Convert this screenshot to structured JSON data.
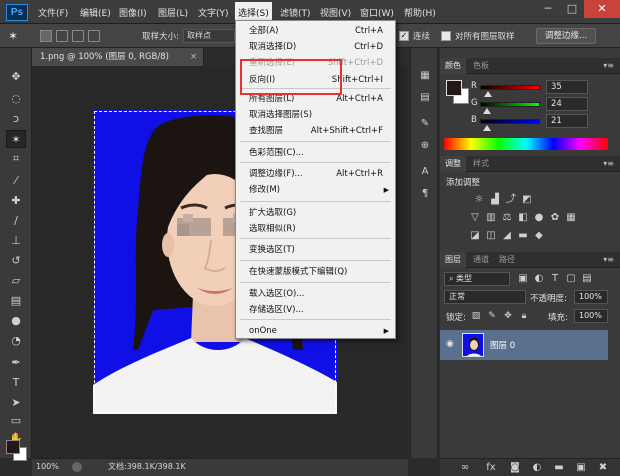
{
  "app": {
    "logo": "Ps"
  },
  "menubar": {
    "items": [
      "文件(F)",
      "编辑(E)",
      "图像(I)",
      "图层(L)",
      "文字(Y)",
      "选择(S)",
      "滤镜(T)",
      "视图(V)",
      "窗口(W)",
      "帮助(H)"
    ],
    "active_index": 5
  },
  "window_controls": {
    "minimize": "─",
    "maximize": "□",
    "close": "✕"
  },
  "options_bar": {
    "sample_size_label": "取样大小:",
    "sample_size_value": "取样点",
    "contiguous_label": "连续",
    "contiguous_checked": true,
    "all_layers_label": "对所有图层取样",
    "all_layers_checked": false,
    "refine_edge_button": "调整边缘..."
  },
  "document": {
    "tab_title": "1.png @ 100% (图层 0, RGB/8)",
    "tab_close": "×",
    "zoom": "100%",
    "doc_info": "文档:398.1K/398.1K"
  },
  "select_menu": {
    "items": [
      {
        "label": "全部(A)",
        "shortcut": "Ctrl+A",
        "disabled": false
      },
      {
        "label": "取消选择(D)",
        "shortcut": "Ctrl+D",
        "disabled": false
      },
      {
        "label": "重新选择(E)",
        "shortcut": "Shift+Ctrl+D",
        "disabled": true
      },
      {
        "label": "反向(I)",
        "shortcut": "Shift+Ctrl+I",
        "disabled": false
      },
      {
        "label": "所有图层(L)",
        "shortcut": "Alt+Ctrl+A",
        "disabled": false
      },
      {
        "label": "取消选择图层(S)",
        "shortcut": "",
        "disabled": false
      },
      {
        "label": "查找图层",
        "shortcut": "Alt+Shift+Ctrl+F",
        "disabled": false
      },
      {
        "label": "色彩范围(C)...",
        "shortcut": "",
        "disabled": false
      },
      {
        "label": "调整边缘(F)...",
        "shortcut": "Alt+Ctrl+R",
        "disabled": false
      },
      {
        "label": "修改(M)",
        "shortcut": "",
        "disabled": false,
        "submenu": true
      },
      {
        "label": "扩大选取(G)",
        "shortcut": "",
        "disabled": false
      },
      {
        "label": "选取相似(R)",
        "shortcut": "",
        "disabled": false
      },
      {
        "label": "变换选区(T)",
        "shortcut": "",
        "disabled": false
      },
      {
        "label": "在快速蒙版模式下编辑(Q)",
        "shortcut": "",
        "disabled": false
      },
      {
        "label": "载入选区(O)...",
        "shortcut": "",
        "disabled": false
      },
      {
        "label": "存储选区(V)...",
        "shortcut": "",
        "disabled": false
      },
      {
        "label": "onOne",
        "shortcut": "",
        "disabled": false,
        "submenu": true
      }
    ],
    "highlighted_item": "反向(I)"
  },
  "color_panel": {
    "tabs": [
      "颜色",
      "色板"
    ],
    "r_label": "R",
    "g_label": "G",
    "b_label": "B",
    "r_value": "35",
    "g_value": "24",
    "b_value": "21",
    "foreground": "#231815",
    "background": "#ffffff"
  },
  "adjustments_panel": {
    "tabs": [
      "调整",
      "样式"
    ],
    "heading": "添加调整",
    "icons": [
      "brightness-icon",
      "levels-icon",
      "curves-icon",
      "exposure-icon",
      "vibrance-icon",
      "hue-icon",
      "color-balance-icon",
      "bw-icon",
      "photo-filter-icon",
      "channel-mixer-icon",
      "color-lookup-icon",
      "invert-icon",
      "posterize-icon",
      "threshold-icon",
      "gradient-map-icon",
      "selective-color-icon"
    ]
  },
  "layers_panel": {
    "tabs": [
      "图层",
      "通道",
      "路径"
    ],
    "filter_label": "类型",
    "blend_mode": "正常",
    "opacity_label": "不透明度:",
    "opacity_value": "100%",
    "lock_label": "锁定:",
    "fill_label": "填充:",
    "fill_value": "100%",
    "layers": [
      {
        "name": "图层 0",
        "visible": true,
        "selected": true
      }
    ]
  },
  "colors": {
    "photo_background": "#1010e6",
    "accent_red": "#e53232"
  }
}
